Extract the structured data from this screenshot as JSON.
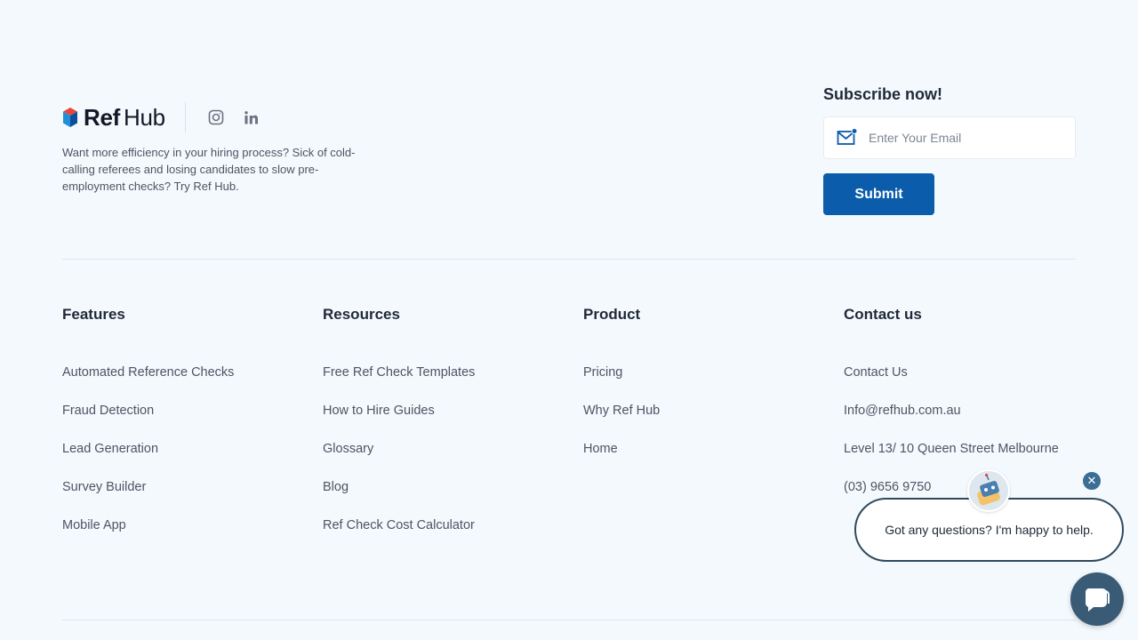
{
  "brand": {
    "logo_bold": "Ref",
    "logo_regular": "Hub",
    "tagline": "Want more efficiency in your hiring process? Sick of cold-calling referees and losing candidates to slow pre-employment checks? Try Ref Hub.",
    "social": [
      {
        "icon": "instagram-icon"
      },
      {
        "icon": "linkedin-icon"
      }
    ]
  },
  "subscribe": {
    "title": "Subscribe now!",
    "email_placeholder": "Enter Your Email",
    "email_value": "",
    "submit_label": "Submit"
  },
  "columns": {
    "features": {
      "title": "Features",
      "items": [
        "Automated Reference Checks",
        "Fraud Detection",
        "Lead Generation",
        "Survey Builder",
        "Mobile App"
      ]
    },
    "resources": {
      "title": "Resources",
      "items": [
        "Free Ref Check Templates",
        "How to Hire Guides",
        "Glossary",
        "Blog",
        "Ref Check Cost Calculator"
      ]
    },
    "product": {
      "title": "Product",
      "items": [
        "Pricing",
        "Why Ref Hub",
        "Home"
      ]
    },
    "contact": {
      "title": "Contact us",
      "items": [
        "Contact Us",
        "Info@refhub.com.au",
        "Level 13/ 10 Queen Street Melbourne",
        "(03) 9656 9750"
      ]
    }
  },
  "chat": {
    "message": "Got any questions? I'm happy to help.",
    "close_symbol": "✕"
  },
  "colors": {
    "background": "#f4f9fd",
    "accent": "#0b5cab",
    "chat_dark": "#3a5b76"
  }
}
